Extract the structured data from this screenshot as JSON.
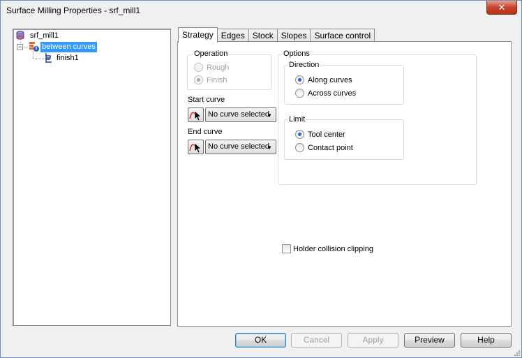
{
  "window": {
    "title": "Surface Milling Properties - srf_mill1",
    "close_glyph": "✕"
  },
  "tree": {
    "root": {
      "label": "srf_mill1",
      "icon": "database-icon"
    },
    "child": {
      "label": "between curves",
      "icon": "operation-icon",
      "expander": "−"
    },
    "leaf": {
      "label": "finish1",
      "icon": "toolpath-icon"
    }
  },
  "tabs": [
    "Strategy",
    "Edges",
    "Stock",
    "Slopes",
    "Surface control"
  ],
  "strategy": {
    "operation": {
      "title": "Operation",
      "rough": "Rough",
      "finish": "Finish"
    },
    "start_curve": {
      "label": "Start curve",
      "value": "No curve selected"
    },
    "end_curve": {
      "label": "End curve",
      "value": "No curve selected"
    },
    "options": {
      "title": "Options",
      "direction": {
        "title": "Direction",
        "along": "Along curves",
        "across": "Across curves"
      },
      "limit": {
        "title": "Limit",
        "tool_center": "Tool center",
        "contact_point": "Contact point"
      }
    },
    "holder_clipping": "Holder collision clipping"
  },
  "buttons": {
    "ok": "OK",
    "cancel": "Cancel",
    "apply": "Apply",
    "preview": "Preview",
    "help": "Help"
  },
  "colors": {
    "selection": "#3399ff",
    "close": "#c7442b"
  }
}
